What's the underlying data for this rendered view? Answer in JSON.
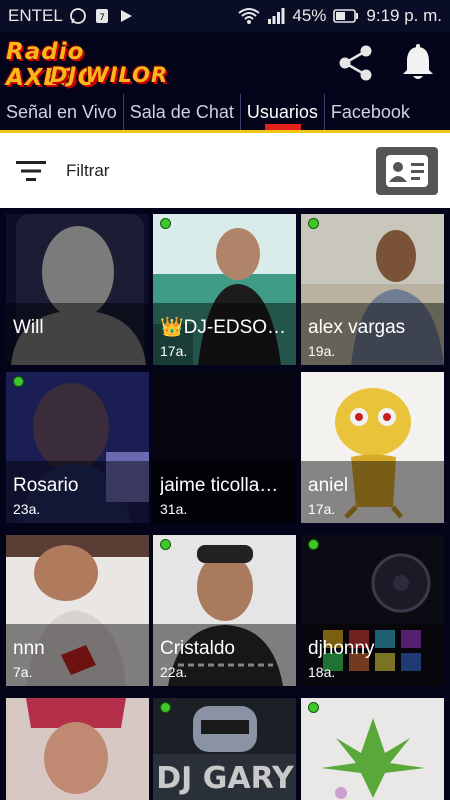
{
  "status_bar": {
    "carrier": "ENTEL",
    "battery": "45%",
    "time": "9:19 p. m."
  },
  "app": {
    "logo_line1": "Radio AXESO",
    "logo_line2": "DJ WILOR",
    "share_icon": "share-icon",
    "bell_icon": "bell-icon"
  },
  "tabs": [
    {
      "label": "Señal en Vivo"
    },
    {
      "label": "Sala de Chat"
    },
    {
      "label": "Usuarios",
      "active": true
    },
    {
      "label": "Facebook"
    }
  ],
  "filter": {
    "label": "Filtrar",
    "filter_icon": "filter-icon",
    "card_icon": "contact-card-icon"
  },
  "users": [
    {
      "name": "Will",
      "age": "",
      "online": false
    },
    {
      "name": "👑DJ-EDSO…",
      "age": "17a.",
      "online": true
    },
    {
      "name": "alex vargas",
      "age": "19a.",
      "online": true
    },
    {
      "name": "Rosario",
      "age": "23a.",
      "online": true
    },
    {
      "name": "jaime ticolla…",
      "age": "31a.",
      "online": false
    },
    {
      "name": "aniel",
      "age": "17a.",
      "online": false
    },
    {
      "name": "nnn",
      "age": "7a.",
      "online": false
    },
    {
      "name": "Cristaldo",
      "age": "22a.",
      "online": true
    },
    {
      "name": "djhonny",
      "age": "18a.",
      "online": true
    },
    {
      "name": "",
      "age": "",
      "online": false
    },
    {
      "name": "",
      "age": "",
      "online": true
    },
    {
      "name": "",
      "age": "",
      "online": true
    }
  ],
  "colors": {
    "background": "#03041a",
    "accent_yellow": "#f0c618",
    "tab_indicator": "#e2211c",
    "online": "#3fc72a"
  }
}
